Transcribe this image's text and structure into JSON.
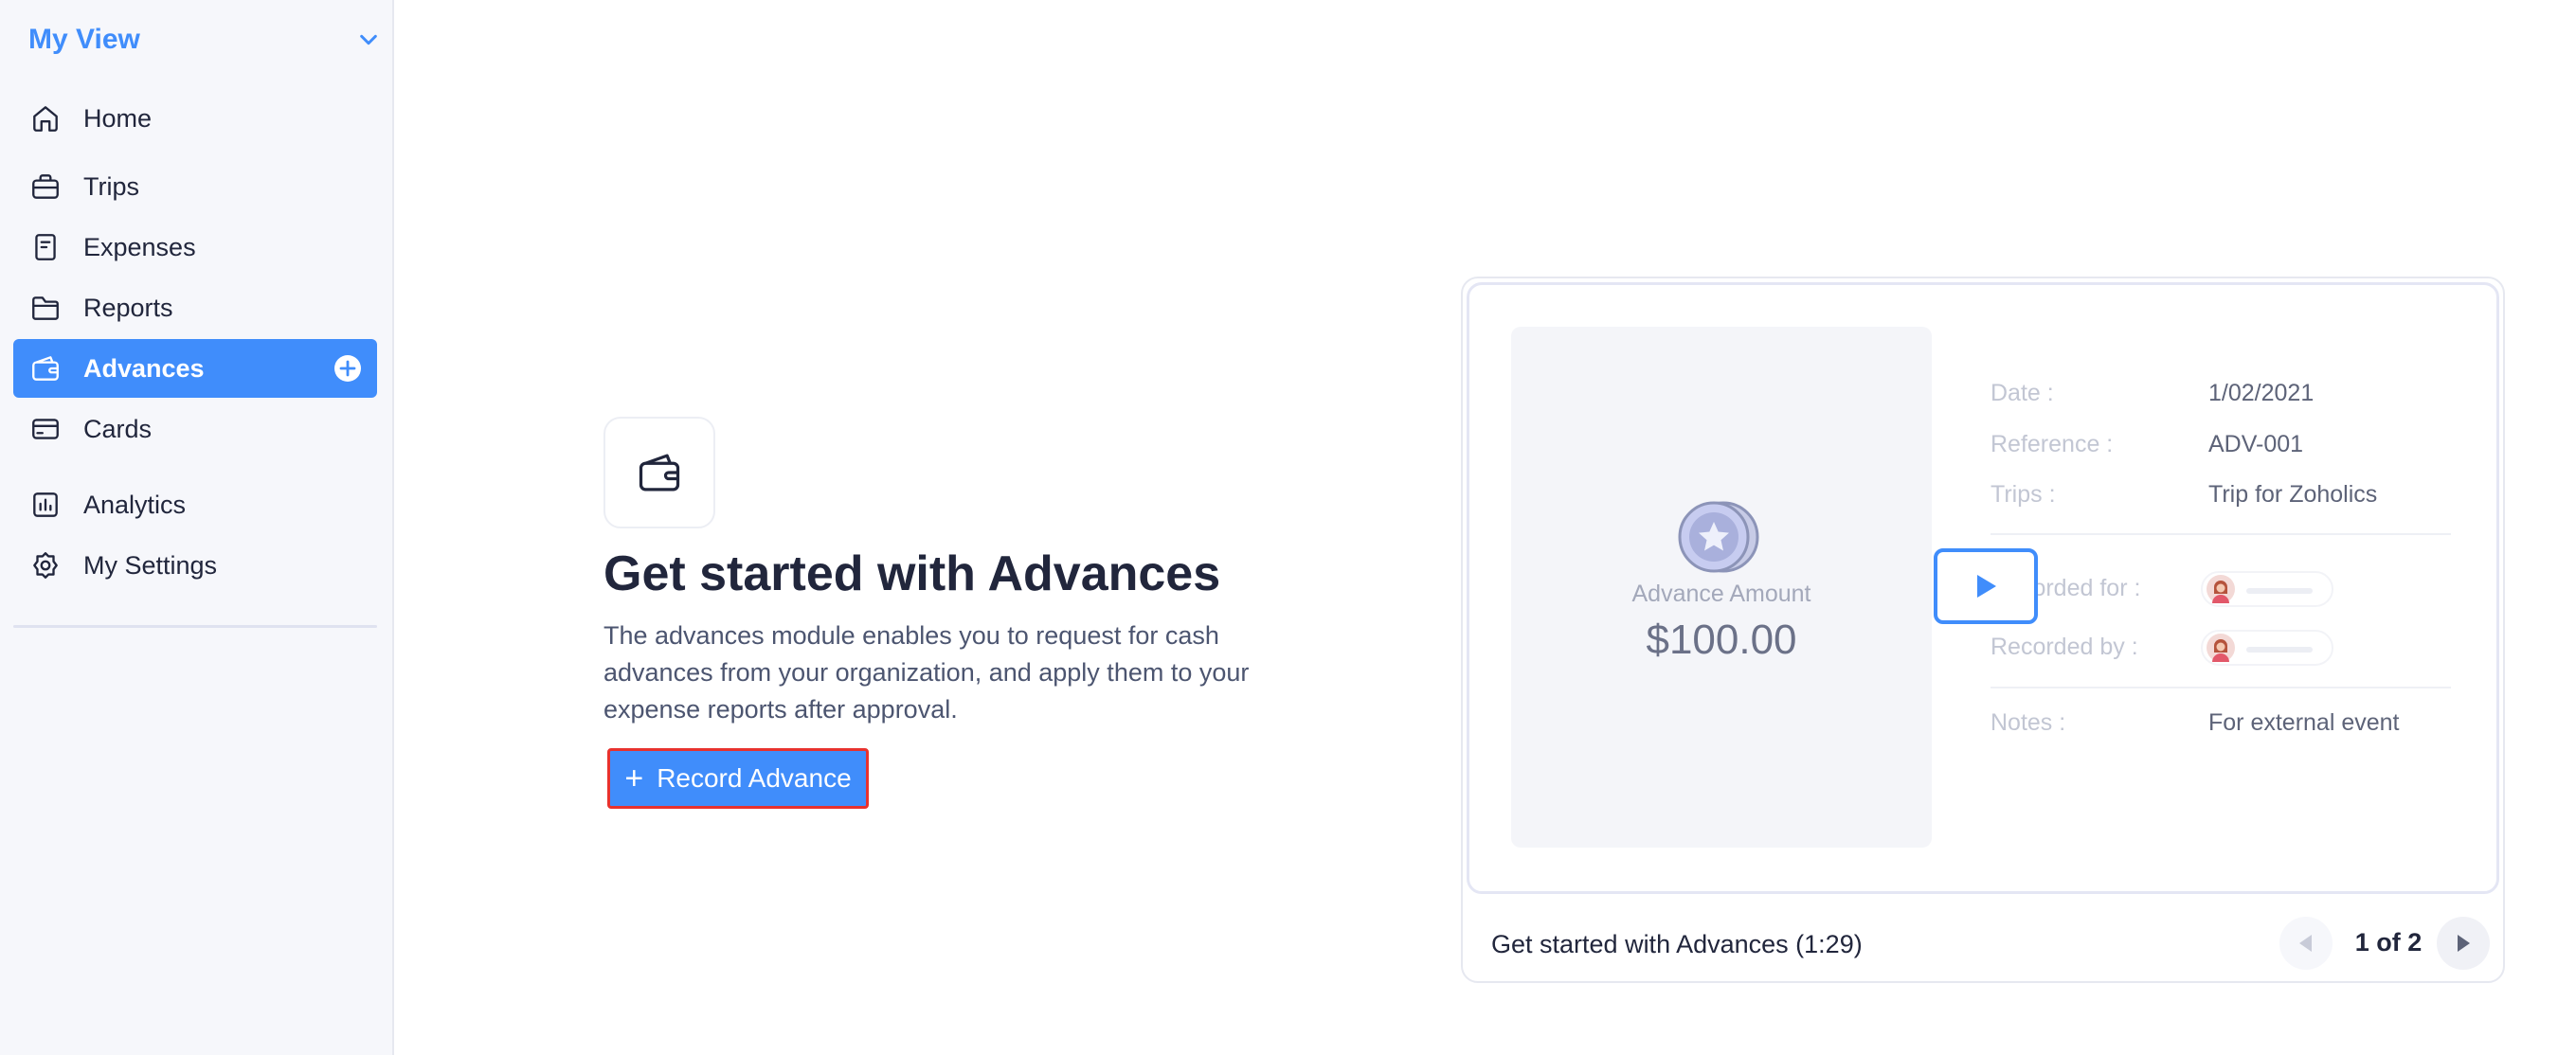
{
  "sidebar": {
    "view_title": "My View",
    "items": [
      {
        "label": "Home",
        "icon": "home-icon"
      },
      {
        "label": "Trips",
        "icon": "briefcase-icon"
      },
      {
        "label": "Expenses",
        "icon": "receipt-icon"
      },
      {
        "label": "Reports",
        "icon": "folder-icon"
      },
      {
        "label": "Advances",
        "icon": "wallet-icon",
        "active": true
      },
      {
        "label": "Cards",
        "icon": "credit-card-icon"
      },
      {
        "label": "Analytics",
        "icon": "chart-icon"
      },
      {
        "label": "My Settings",
        "icon": "gear-icon"
      }
    ]
  },
  "main": {
    "heading": "Get started with Advances",
    "description": "The advances module enables you to request for cash advances from your organization, and apply them to your expense reports after approval.",
    "record_button": "Record Advance"
  },
  "video": {
    "amount_label": "Advance Amount",
    "amount_value": "$100.00",
    "details": [
      {
        "key": "Date :",
        "value": "1/02/2021"
      },
      {
        "key": "Reference :",
        "value": "ADV-001"
      },
      {
        "key": "Trips :",
        "value": "Trip for Zoholics"
      },
      {
        "key": "Recorded for :"
      },
      {
        "key": "Recorded by :"
      },
      {
        "key": "Notes :",
        "value": "For external event"
      }
    ],
    "title": "Get started with Advances (1:29)",
    "pager": "1 of 2"
  },
  "colors": {
    "accent": "#408dfb",
    "highlight_border": "#e8322e",
    "text_dark": "#21263c"
  }
}
